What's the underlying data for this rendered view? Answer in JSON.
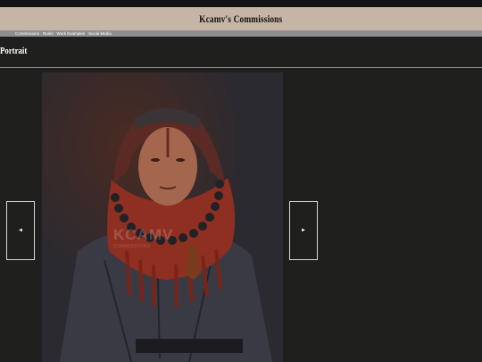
{
  "header": {
    "title": "Kcamv's Commissions"
  },
  "nav": {
    "items": [
      "Commissions",
      "Rules",
      "Work Examples",
      "Social Media"
    ]
  },
  "section": {
    "title": "Portrait"
  },
  "artwork": {
    "watermark_lines": [
      "KCAMV",
      "COMMISSIONS"
    ]
  },
  "carousel": {
    "prev_symbol": "◄",
    "next_symbol": "►"
  },
  "colors": {
    "titlebar": "#c6b5a4",
    "navbar": "#8f8f8f",
    "page_bg": "#1f1f1d",
    "scarf": "#8e2f22"
  }
}
